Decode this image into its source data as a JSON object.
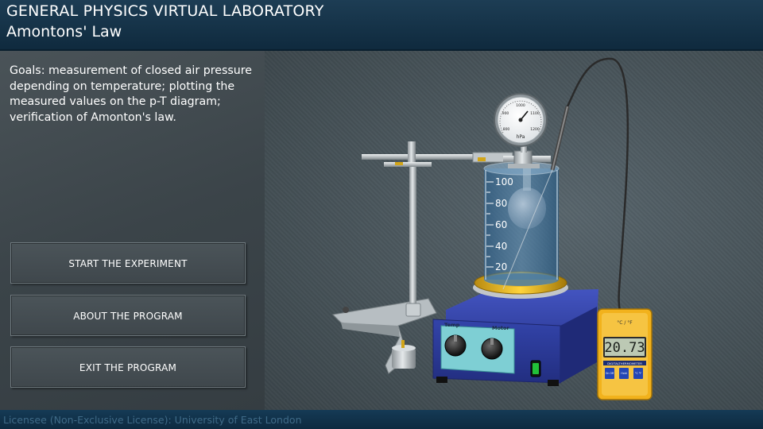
{
  "header": {
    "title": "GENERAL PHYSICS VIRTUAL LABORATORY",
    "subtitle": "Amontons' Law"
  },
  "goals": "Goals: measurement of closed air pressure depending on temperature; plotting the measured values on the p-T diagram; verification of Amonton's law.",
  "menu": {
    "start": "START THE EXPERIMENT",
    "about": "ABOUT THE PROGRAM",
    "exit": "EXIT THE PROGRAM"
  },
  "apparatus": {
    "gauge_unit": "hPa",
    "gauge_ticks": [
      "800",
      "900",
      "1000",
      "1100",
      "1200"
    ],
    "beaker_scale": [
      "100",
      "80",
      "60",
      "40",
      "20"
    ],
    "stirrer_labels": {
      "temp": "Temp",
      "motor": "Motor"
    },
    "thermometer": {
      "unit_label": "°C / °F",
      "reading": "20.73",
      "brand": "DIGITALTHERMOMETER",
      "btn_on": "On Off",
      "btn_hold": "Hold",
      "btn_unit": "°C °F"
    }
  },
  "footer": {
    "licensee": "Licensee (Non-Exclusive License): University of East London"
  },
  "colors": {
    "header_bg": "#133449",
    "stirrer_body": "#2f3e9e",
    "thermometer_body": "#f2b21c",
    "lcd": "#bcc9b4",
    "power_switch": "#22c039"
  }
}
